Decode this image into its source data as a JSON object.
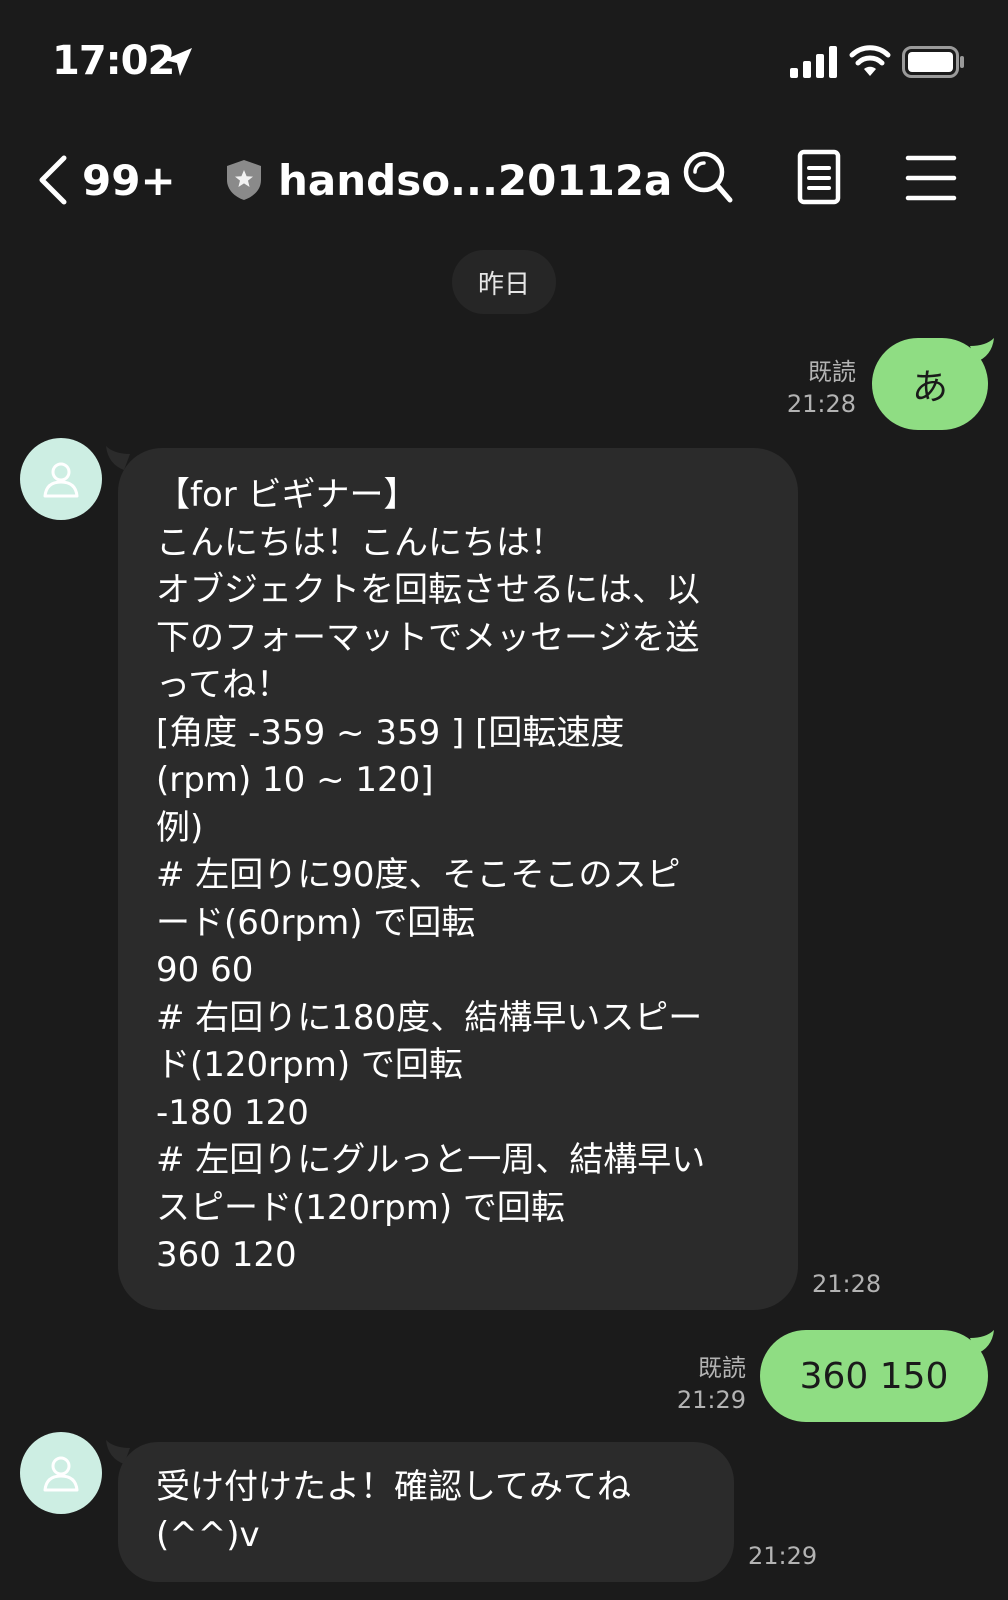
{
  "status_bar": {
    "time": "17:02",
    "icons": [
      "location-arrow-icon",
      "cellular-signal-icon",
      "wifi-icon",
      "battery-icon"
    ]
  },
  "header": {
    "unread_count": "99+",
    "title": "handso...20112a",
    "icons": [
      "chevron-left-icon",
      "shield-icon",
      "search-icon",
      "notes-icon",
      "menu-icon"
    ]
  },
  "chat": {
    "date_label": "昨日",
    "messages": [
      {
        "direction": "out",
        "text": "あ",
        "read_label": "既読",
        "time": "21:28"
      },
      {
        "direction": "in",
        "lines": [
          "【for ビギナー】",
          "こんにちは！こんにちは！",
          "オブジェクトを回転させるには、以",
          "下のフォーマットでメッセージを送",
          "ってね！",
          "[角度 -359 ~ 359 ] [回転速度",
          "(rpm) 10 ~ 120]",
          "例)",
          "# 左回りに90度、そこそこのスピ",
          "ード(60rpm) で回転",
          "90 60",
          "# 右回りに180度、結構早いスピー",
          "ド(120rpm) で回転",
          "-180 120",
          "# 左回りにグルっと一周、結構早い",
          "スピード(120rpm) で回転",
          "360 120"
        ],
        "time": "21:28"
      },
      {
        "direction": "out",
        "text": "360 150",
        "read_label": "既読",
        "time": "21:29"
      },
      {
        "direction": "in",
        "lines": [
          "受け付けたよ！確認してみてね",
          "(^^)v"
        ],
        "time": "21:29"
      }
    ]
  },
  "colors": {
    "background": "#1b1b1b",
    "outgoing_bubble": "#8fdd83",
    "incoming_bubble": "#2b2b2b",
    "avatar": "#cdeee3"
  }
}
